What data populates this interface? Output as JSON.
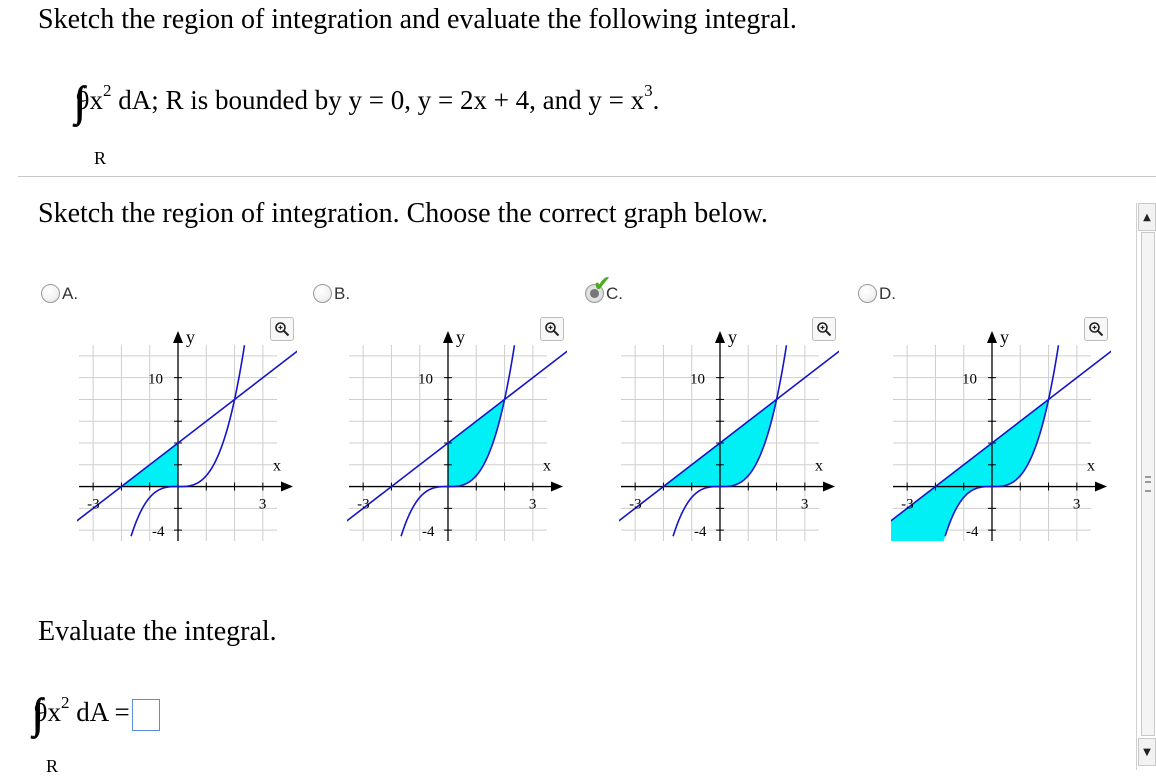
{
  "question": {
    "title": "Sketch the region of integration and evaluate the following integral.",
    "integrand": "9x",
    "integrand_power": "2",
    "differential": "dA; R is bounded by y = 0, y = 2x + 4, and y = x",
    "cube_power": "3",
    "period": ".",
    "region_label": "R"
  },
  "part1": {
    "prompt": "Sketch the region of integration. Choose the correct graph below.",
    "selected": "C",
    "choices": [
      {
        "letter": "A.",
        "axis_x": "x",
        "axis_y": "y",
        "tick_ymax": "10",
        "tick_ymin": "-4",
        "tick_xmin": "-3",
        "tick_xmax": "3",
        "shade": "left"
      },
      {
        "letter": "B.",
        "axis_x": "x",
        "axis_y": "y",
        "tick_ymax": "10",
        "tick_ymin": "-4",
        "tick_xmin": "-3",
        "tick_xmax": "3",
        "shade": "right"
      },
      {
        "letter": "C.",
        "axis_x": "x",
        "axis_y": "y",
        "tick_ymax": "10",
        "tick_ymin": "-4",
        "tick_xmin": "-3",
        "tick_xmax": "3",
        "shade": "full"
      },
      {
        "letter": "D.",
        "axis_x": "x",
        "axis_y": "y",
        "tick_ymax": "10",
        "tick_ymin": "-4",
        "tick_xmin": "-3",
        "tick_xmax": "3",
        "shade": "wrong"
      }
    ],
    "colors": {
      "curve": "#1515c8",
      "shade": "#00f0f5",
      "grid": "#cfcfcf",
      "check": "#4caa1e"
    }
  },
  "part2": {
    "prompt": "Evaluate the integral.",
    "integrand": "9x",
    "integrand_power": "2",
    "differential": "dA =",
    "answer_value": "",
    "region_label": "R"
  },
  "icons": {
    "zoom": "zoom-in-icon",
    "check": "checkmark-icon",
    "scroll_up": "arrow-up-icon",
    "scroll_down": "arrow-down-icon"
  }
}
